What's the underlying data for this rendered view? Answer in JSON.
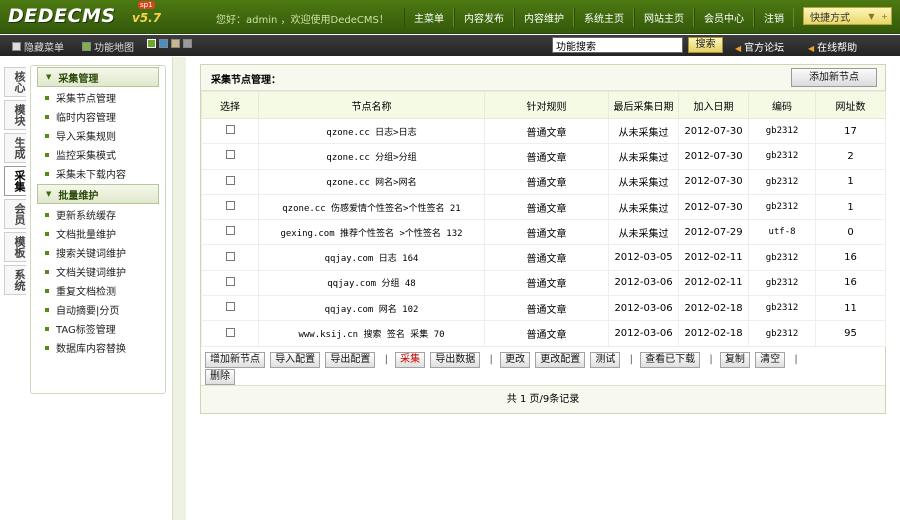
{
  "logo": {
    "text": "DEDECMS",
    "version": "v5.7",
    "badge": "sp1"
  },
  "top_nav": {
    "welcome": "您好：admin ，欢迎使用DedeCMS！",
    "items": [
      "主菜单",
      "内容发布",
      "内容维护",
      "系统主页",
      "网站主页",
      "会员中心",
      "注销"
    ],
    "quick_label": "快捷方式"
  },
  "sub_bar": {
    "hide_menu": "隐藏菜单",
    "site_map": "功能地图",
    "search_value": "功能搜索",
    "search_button": "搜索",
    "forum": "官方论坛",
    "help": "在线帮助"
  },
  "sidebar": {
    "tabs": [
      "核心",
      "模块",
      "生成",
      "采集",
      "会员",
      "模板",
      "系统"
    ],
    "active_tab": "采集",
    "groups": [
      {
        "title": "采集管理",
        "items": [
          "采集节点管理",
          "临时内容管理",
          "导入采集规则",
          "监控采集模式",
          "采集未下载内容"
        ]
      },
      {
        "title": "批量维护",
        "items": [
          "更新系统缓存",
          "文档批量维护",
          "搜索关键词维护",
          "文档关键词维护",
          "重复文档检测",
          "自动摘要|分页",
          "TAG标签管理",
          "数据库内容替换"
        ]
      }
    ]
  },
  "main": {
    "title": "采集节点管理：",
    "add_button": "添加新节点",
    "columns": [
      "选择",
      "节点名称",
      "针对规则",
      "最后采集日期",
      "加入日期",
      "编码",
      "网址数"
    ],
    "rows": [
      [
        "qzone.cc 日志>日志",
        "普通文章",
        "从未采集过",
        "2012-07-30",
        "gb2312",
        "17"
      ],
      [
        "qzone.cc 分组>分组",
        "普通文章",
        "从未采集过",
        "2012-07-30",
        "gb2312",
        "2"
      ],
      [
        "qzone.cc 网名>网名",
        "普通文章",
        "从未采集过",
        "2012-07-30",
        "gb2312",
        "1"
      ],
      [
        "qzone.cc 伤感爱情个性签名>个性签名 21",
        "普通文章",
        "从未采集过",
        "2012-07-30",
        "gb2312",
        "1"
      ],
      [
        "gexing.com 推荐个性签名 >个性签名 132",
        "普通文章",
        "从未采集过",
        "2012-07-29",
        "utf-8",
        "0"
      ],
      [
        "qqjay.com 日志 164",
        "普通文章",
        "2012-03-05",
        "2012-02-11",
        "gb2312",
        "16"
      ],
      [
        "qqjay.com 分组 48",
        "普通文章",
        "2012-03-06",
        "2012-02-11",
        "gb2312",
        "16"
      ],
      [
        "qqjay.com 网名 102",
        "普通文章",
        "2012-03-06",
        "2012-02-18",
        "gb2312",
        "11"
      ],
      [
        "www.ksij.cn 搜索 签名 采集 70",
        "普通文章",
        "2012-03-06",
        "2012-02-18",
        "gb2312",
        "95"
      ]
    ],
    "actions": [
      "增加新节点",
      "导入配置",
      "导出配置",
      "采集",
      "导出数据",
      "更改",
      "更改配置",
      "测试",
      "查看已下载",
      "复制",
      "清空",
      "删除"
    ],
    "footer": "共 1 页/9条记录"
  },
  "colors": {
    "topbar": "#3e6a0e",
    "accent_yellow": "#f6d24a",
    "header_bg": "#f5fae5",
    "red_action": "#cc0000"
  }
}
